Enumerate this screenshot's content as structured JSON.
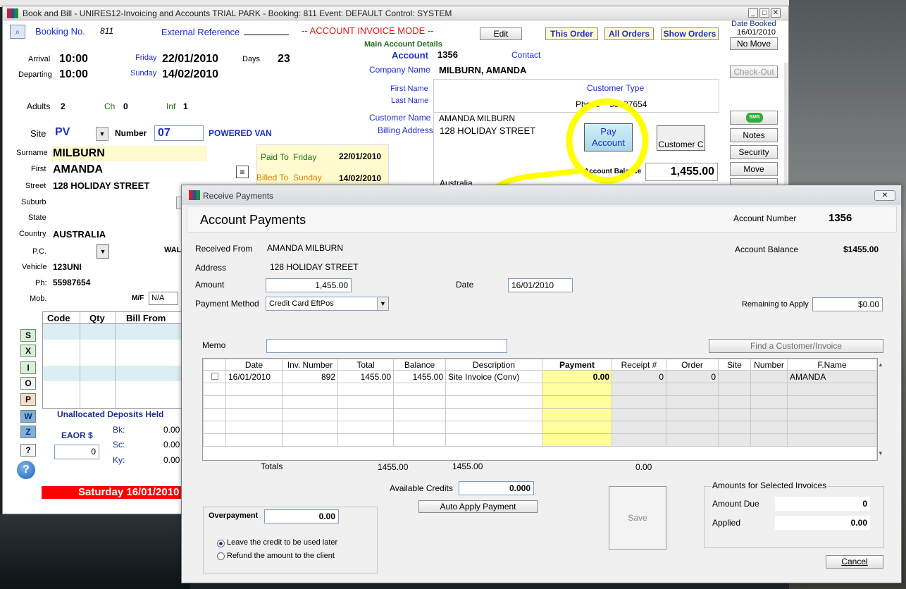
{
  "main": {
    "title": "Book and Bill - UNIRES12-Invoicing and Accounts TRIAL PARK - Booking: 811 Event: DEFAULT Control: SYSTEM",
    "booking_no_label": "Booking No.",
    "booking_no": "811",
    "external_ref_label": "External Reference",
    "mode": "-- ACCOUNT INVOICE MODE --",
    "edit": "Edit",
    "this_order": "This Order",
    "all_orders": "All Orders",
    "show_orders": "Show Orders",
    "date_booked_label": "Date Booked",
    "date_booked": "16/01/2010",
    "no_move": "No Move",
    "check_out": "Check-Out",
    "arrival_label": "Arrival",
    "arrival_time": "10:00",
    "arrival_day": "Friday",
    "arrival_date": "22/01/2010",
    "days_label": "Days",
    "days": "23",
    "departing_label": "Departing",
    "departing_time": "10:00",
    "departing_day": "Sunday",
    "departing_date": "14/02/2010",
    "adults_label": "Adults",
    "adults": "2",
    "ch_label": "Ch",
    "ch": "0",
    "inf_label": "Inf",
    "inf": "1",
    "site_label": "Site",
    "site": "PV",
    "number_label": "Number",
    "number": "07",
    "site_type": "POWERED VAN",
    "surname_label": "Surname",
    "surname": "MILBURN",
    "first_label": "First",
    "first": "AMANDA",
    "street_label": "Street",
    "street": "128 HOLIDAY STREET",
    "suburb_label": "Suburb",
    "state_label": "State",
    "country_label": "Country",
    "country": "AUSTRALIA",
    "pc_label": "P.C.",
    "wal": "WAL",
    "vehicle_label": "Vehicle",
    "vehicle": "123UNI",
    "ph_label": "Ph:",
    "ph": "55987654",
    "mob_label": "Mob.",
    "mf_label": "M/F",
    "mf": "N/A",
    "paid_to_label": "Paid To",
    "paid_to_day": "Friday",
    "paid_to_date": "22/01/2010",
    "billed_to_label": "Billed To",
    "billed_to_day": "Sunday",
    "billed_to_date": "14/02/2010",
    "main_account_details": "Main Account Details",
    "account_label": "Account",
    "account": "1356",
    "contact_label": "Contact",
    "company_name_label": "Company Name",
    "company_name": "MILBURN, AMANDA",
    "first_name_label": "First Name",
    "last_name_label": "Last Name",
    "customer_type_label": "Customer Type",
    "phone_label": "Phone",
    "phone": "55987654",
    "customer_name_label": "Customer Name",
    "customer_name": "AMANDA MILBURN",
    "billing_address_label": "Billing Address",
    "billing_address": "128 HOLIDAY STREET",
    "billing_country": "Australia",
    "pay_account": "Pay Account",
    "customer_c": "Customer C",
    "account_balance_label": "Account Balance",
    "account_balance": "1,455.00",
    "side_buttons": [
      "Notes",
      "Security",
      "Move"
    ],
    "sms": "SMS",
    "grid_headers": [
      "Code",
      "Qty",
      "Bill From"
    ],
    "letter_buttons": [
      "S",
      "X",
      "I",
      "O",
      "P",
      "W",
      "Z",
      "?"
    ],
    "unallocated": "Unallocated Deposits Held",
    "eaor_label": "EAOR $",
    "eaor": "0",
    "bk_label": "Bk:",
    "bk": "0.00",
    "sc_label": "Sc:",
    "sc": "0.00",
    "ky_label": "Ky:",
    "ky": "0.00",
    "date_banner": "Saturday 16/01/2010"
  },
  "dialog": {
    "title": "Receive Payments",
    "heading": "Account Payments",
    "account_number_label": "Account Number",
    "account_number": "1356",
    "received_from_label": "Received From",
    "received_from": "AMANDA MILBURN",
    "address_label": "Address",
    "address": "128 HOLIDAY STREET",
    "amount_label": "Amount",
    "amount": "1,455.00",
    "date_label": "Date",
    "date": "16/01/2010",
    "payment_method_label": "Payment Method",
    "payment_method": "Credit Card EftPos",
    "account_balance_label": "Account Balance",
    "account_balance": "$1455.00",
    "remaining_label": "Remaining to Apply",
    "remaining": "$0.00",
    "memo_label": "Memo",
    "find_btn": "Find a Customer/Invoice",
    "columns": [
      "",
      "Date",
      "Inv. Number",
      "Total",
      "Balance",
      "Description",
      "Payment",
      "Receipt #",
      "Order",
      "Site",
      "Number",
      "F.Name"
    ],
    "row": {
      "date": "16/01/2010",
      "inv": "892",
      "total": "1455.00",
      "balance": "1455.00",
      "description": "Site Invoice (Conv)",
      "payment": "0.00",
      "receipt": "0",
      "order": "0",
      "site": "",
      "number": "",
      "fname": "AMANDA"
    },
    "totals_label": "Totals",
    "totals_total": "1455.00",
    "totals_balance": "1455.00",
    "totals_payment": "0.00",
    "available_credits_label": "Available Credits",
    "available_credits": "0.000",
    "auto_apply": "Auto Apply Payment",
    "save": "Save",
    "amounts_group": "Amounts for Selected Invoices",
    "amount_due_label": "Amount Due",
    "amount_due": "0",
    "applied_label": "Applied",
    "applied": "0.00",
    "overpayment_label": "Overpayment",
    "overpayment": "0.00",
    "radio_leave": "Leave the credit to be used later",
    "radio_refund": "Refund the amount to the client",
    "cancel": "Cancel"
  },
  "colors": {
    "highlight": "#ffff00",
    "payment_col": "#fffe9a",
    "mode_red": "#e01515",
    "banner_red": "#ff0000"
  }
}
